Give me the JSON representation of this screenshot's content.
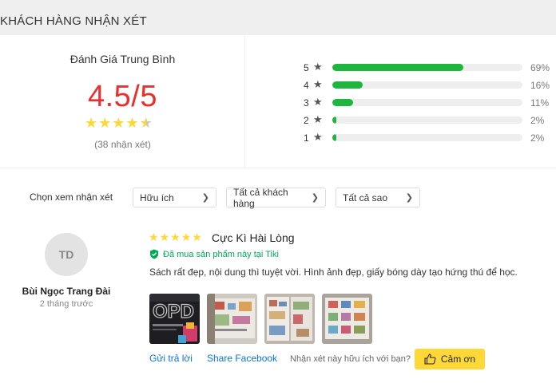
{
  "section_title": "KHÁCH HÀNG NHẬN XÉT",
  "summary": {
    "avg_label": "Đánh Giá Trung Bình",
    "avg_score": "4.5/5",
    "rating_value": 4.5,
    "review_count": "(38 nhận xét)",
    "breakdown": [
      {
        "stars": "5",
        "percent": "69%",
        "fill": 69
      },
      {
        "stars": "4",
        "percent": "16%",
        "fill": 16
      },
      {
        "stars": "3",
        "percent": "11%",
        "fill": 11
      },
      {
        "stars": "2",
        "percent": "2%",
        "fill": 2
      },
      {
        "stars": "1",
        "percent": "2%",
        "fill": 2
      }
    ]
  },
  "filters": {
    "label": "Chọn xem nhận xét",
    "sort": "Hữu ích",
    "customers": "Tất cả khách hàng",
    "stars": "Tất cả sao"
  },
  "review": {
    "avatar_initials": "TD",
    "user_name": "Bùi Ngọc Trang Đài",
    "time": "2 tháng trước",
    "rating": 5,
    "title": "Cực Kì Hài Lòng",
    "purchased": "Đã mua sản phẩm này tại Tiki",
    "content": "Sách rất đẹp, nội dung thì tuyệt vời. Hình ảnh đẹp, giấy bóng dày tạo hứng thú để học.",
    "reply": "Gửi trả lời",
    "share": "Share Facebook",
    "helpful_question": "Nhận xét này hữu ích với bạn?",
    "thanks": "Cảm ơn"
  },
  "colors": {
    "bar_fill": "#1fb53f",
    "score": "#e8312f",
    "star": "#fdd836",
    "link": "#0b74e5",
    "verified": "#00ab56"
  }
}
